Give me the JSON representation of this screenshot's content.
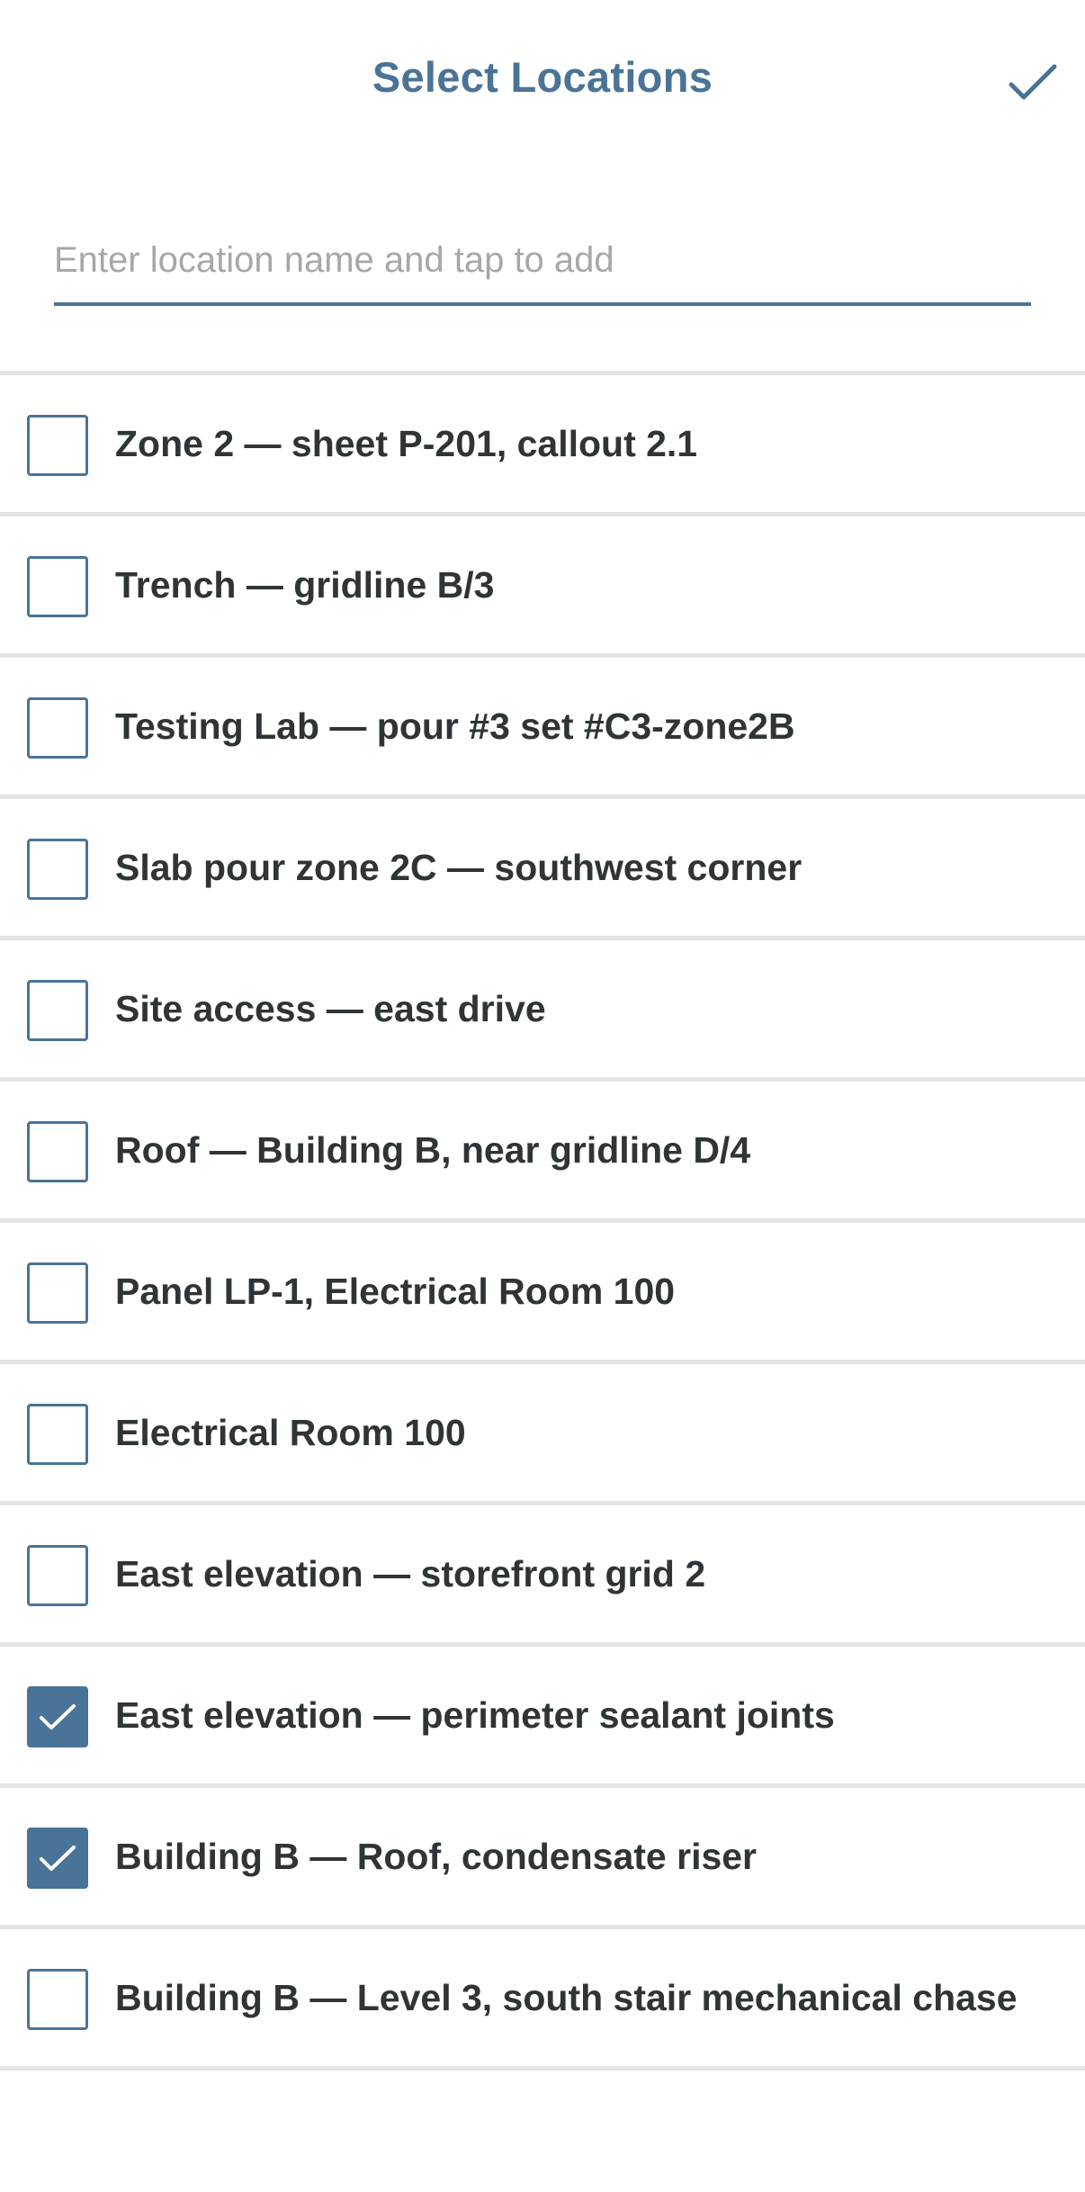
{
  "header": {
    "title": "Select Locations",
    "done_icon": "checkmark-icon"
  },
  "search": {
    "value": "",
    "placeholder": "Enter location name and tap to add"
  },
  "colors": {
    "accent": "#4a7398",
    "text": "#2f3437",
    "placeholder": "#a5a8ab",
    "divider": "#e3e4e5"
  },
  "locations": [
    {
      "label": "Zone 2 — sheet P-201, callout 2.1",
      "checked": false
    },
    {
      "label": "Trench — gridline B/3",
      "checked": false
    },
    {
      "label": "Testing Lab — pour #3 set #C3-zone2B",
      "checked": false
    },
    {
      "label": "Slab pour zone 2C — southwest corner",
      "checked": false
    },
    {
      "label": "Site access — east drive",
      "checked": false
    },
    {
      "label": "Roof — Building B, near gridline D/4",
      "checked": false
    },
    {
      "label": "Panel LP-1, Electrical Room 100",
      "checked": false
    },
    {
      "label": "Electrical Room 100",
      "checked": false
    },
    {
      "label": "East elevation — storefront grid 2",
      "checked": false
    },
    {
      "label": "East elevation — perimeter sealant joints",
      "checked": true
    },
    {
      "label": "Building B — Roof, condensate riser",
      "checked": true
    },
    {
      "label": "Building B — Level 3, south stair mechanical chase",
      "checked": false
    }
  ]
}
